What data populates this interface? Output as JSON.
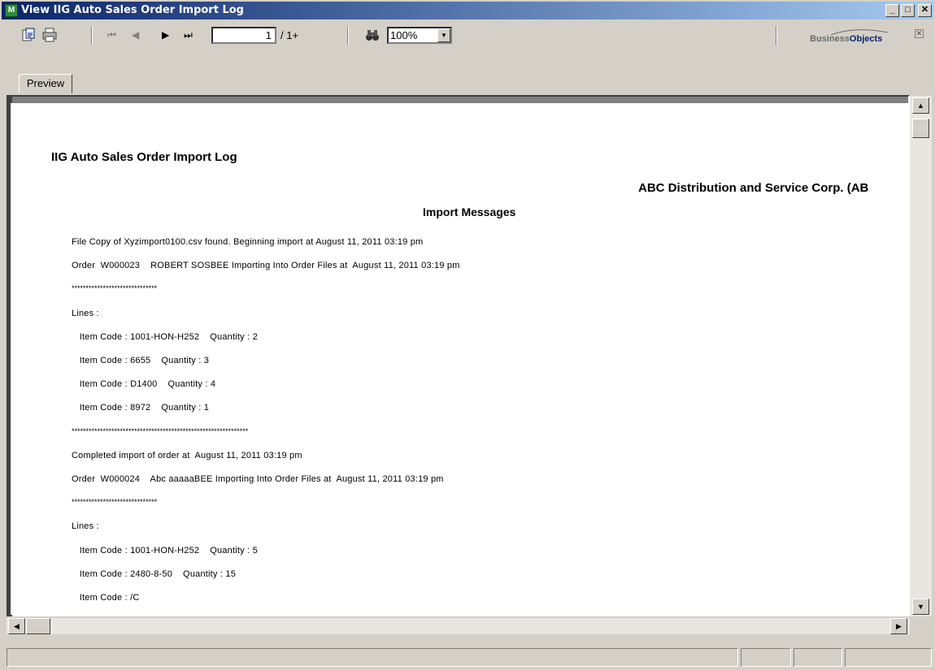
{
  "window": {
    "title": "View IIG Auto Sales Order Import Log",
    "icon": "app-icon",
    "minimize": "_",
    "maximize": "□",
    "close": "✕"
  },
  "toolbar": {
    "export_icon": "export-icon",
    "print_icon": "print-icon",
    "first_page": "⏮",
    "prev_page": "◀",
    "next_page": "▶",
    "last_page": "⏭",
    "page_value": "1",
    "page_total": "/ 1+",
    "search_icon": "binoculars-icon",
    "zoom_value": "100%",
    "logo_prefix": "Business",
    "logo_suffix": "Objects",
    "logo_close": "✕"
  },
  "tabs": [
    {
      "label": "Preview"
    }
  ],
  "report": {
    "title": "IIG Auto Sales Order Import Log",
    "company": "ABC Distribution and Service Corp. (AB",
    "subtitle": "Import  Messages",
    "lines": [
      "File Copy of Xyzimport0100.csv found. Beginning import at August 11, 2011 03:19 pm",
      "Order  W000023    ROBERT SOSBEE Importing Into Order Files at  August 11, 2011 03:19 pm",
      "******************************",
      "Lines :",
      "   Item Code : 1001-HON-H252    Quantity : 2",
      "   Item Code : 6655    Quantity : 3",
      "   Item Code : D1400    Quantity : 4",
      "   Item Code : 8972    Quantity : 1",
      "**************************************************************",
      "Completed import of order at  August 11, 2011 03:19 pm",
      "Order  W000024    Abc aaaaaBEE Importing Into Order Files at  August 11, 2011 03:19 pm",
      "******************************",
      "Lines :",
      "   Item Code : 1001-HON-H252    Quantity : 5",
      "   Item Code : 2480-8-50    Quantity : 15",
      "   Item Code : /C"
    ]
  },
  "scrollbar": {
    "up": "▲",
    "down": "▼",
    "left": "◀",
    "right": "▶"
  }
}
